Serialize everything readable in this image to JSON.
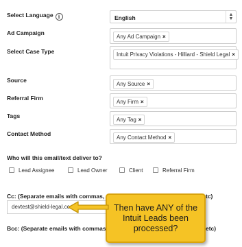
{
  "form": {
    "language": {
      "label": "Select Language",
      "value": "English"
    },
    "ad_campaign": {
      "label": "Ad Campaign",
      "tag": "Any Ad Campaign"
    },
    "case_type": {
      "label": "Select Case Type",
      "tag": "Intuit Privacy Violations - Hilliard - Shield Legal"
    },
    "source": {
      "label": "Source",
      "tag": "Any Source"
    },
    "referral_firm": {
      "label": "Referral Firm",
      "tag": "Any Firm"
    },
    "tags": {
      "label": "Tags",
      "tag": "Any Tag"
    },
    "contact_method": {
      "label": "Contact Method",
      "tag": "Any Contact Method"
    },
    "deliver_to": {
      "label": "Who will this email/text deliver to?",
      "options": [
        "Lead Assignee",
        "Lead Owner",
        "Client",
        "Referral Firm"
      ]
    },
    "cc": {
      "label_left": "Cc: (Separate emails with commas, ex: e",
      "label_right": "tc)",
      "value": "devtest@shield-legal.com"
    },
    "bcc": {
      "label_left": "Bcc: (Separate emails with commas, ex:",
      "label_right": "etc)"
    }
  },
  "callout": {
    "text": "Then have ANY of the Intuit Leads been processed?"
  },
  "icons": {
    "remove": "×",
    "info": "i"
  }
}
